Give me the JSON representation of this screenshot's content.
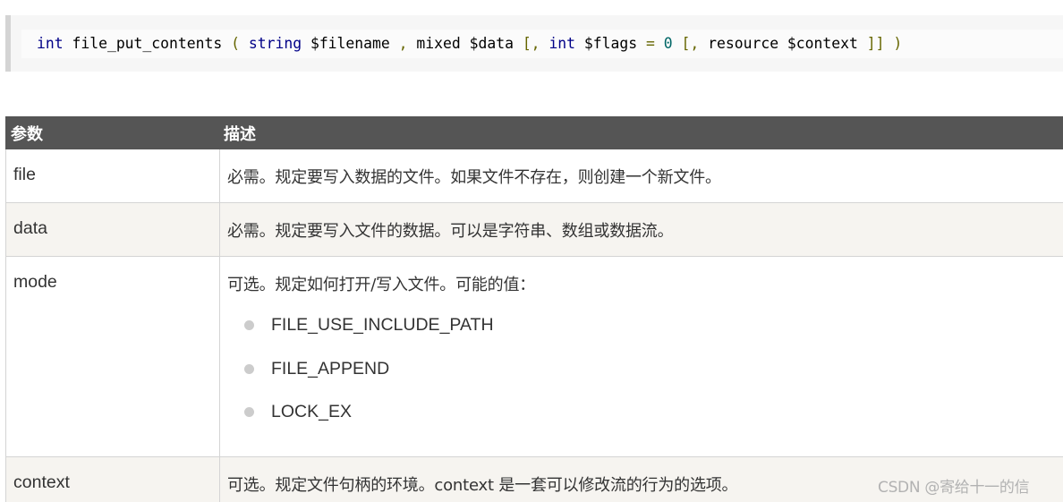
{
  "code": {
    "tokens": [
      {
        "t": "int",
        "c": "kw"
      },
      {
        "t": " file_put_contents ",
        "c": "pln"
      },
      {
        "t": "(",
        "c": "pun"
      },
      {
        "t": " ",
        "c": "pln"
      },
      {
        "t": "string",
        "c": "kw"
      },
      {
        "t": " $filename ",
        "c": "pln"
      },
      {
        "t": ",",
        "c": "pun"
      },
      {
        "t": " mixed $data ",
        "c": "pln"
      },
      {
        "t": "[,",
        "c": "pun"
      },
      {
        "t": " ",
        "c": "pln"
      },
      {
        "t": "int",
        "c": "kw"
      },
      {
        "t": " $flags ",
        "c": "pln"
      },
      {
        "t": "=",
        "c": "pun"
      },
      {
        "t": " ",
        "c": "pln"
      },
      {
        "t": "0",
        "c": "num"
      },
      {
        "t": " ",
        "c": "pln"
      },
      {
        "t": "[,",
        "c": "pun"
      },
      {
        "t": " resource $context ",
        "c": "pln"
      },
      {
        "t": "]]",
        "c": "pun"
      },
      {
        "t": " ",
        "c": "pln"
      },
      {
        "t": ")",
        "c": "pun"
      }
    ]
  },
  "table": {
    "headers": {
      "param": "参数",
      "desc": "描述"
    },
    "rows": [
      {
        "name": "file",
        "desc": "必需。规定要写入数据的文件。如果文件不存在，则创建一个新文件。"
      },
      {
        "name": "data",
        "desc": "必需。规定要写入文件的数据。可以是字符串、数组或数据流。"
      },
      {
        "name": "mode",
        "desc": "可选。规定如何打开/写入文件。可能的值：",
        "options": [
          "FILE_USE_INCLUDE_PATH",
          "FILE_APPEND",
          "LOCK_EX"
        ]
      },
      {
        "name": "context",
        "desc": "可选。规定文件句柄的环境。context 是一套可以修改流的行为的选项。"
      }
    ]
  },
  "watermark": "CSDN @寄给十一的信",
  "colors": {
    "header_bg": "#555555",
    "row_alt_bg": "#f6f4f0",
    "code_bg": "#f6f6f6",
    "code_keyword": "#000088",
    "code_punct": "#666600",
    "code_number": "#006666",
    "bullet": "#cccccc"
  }
}
